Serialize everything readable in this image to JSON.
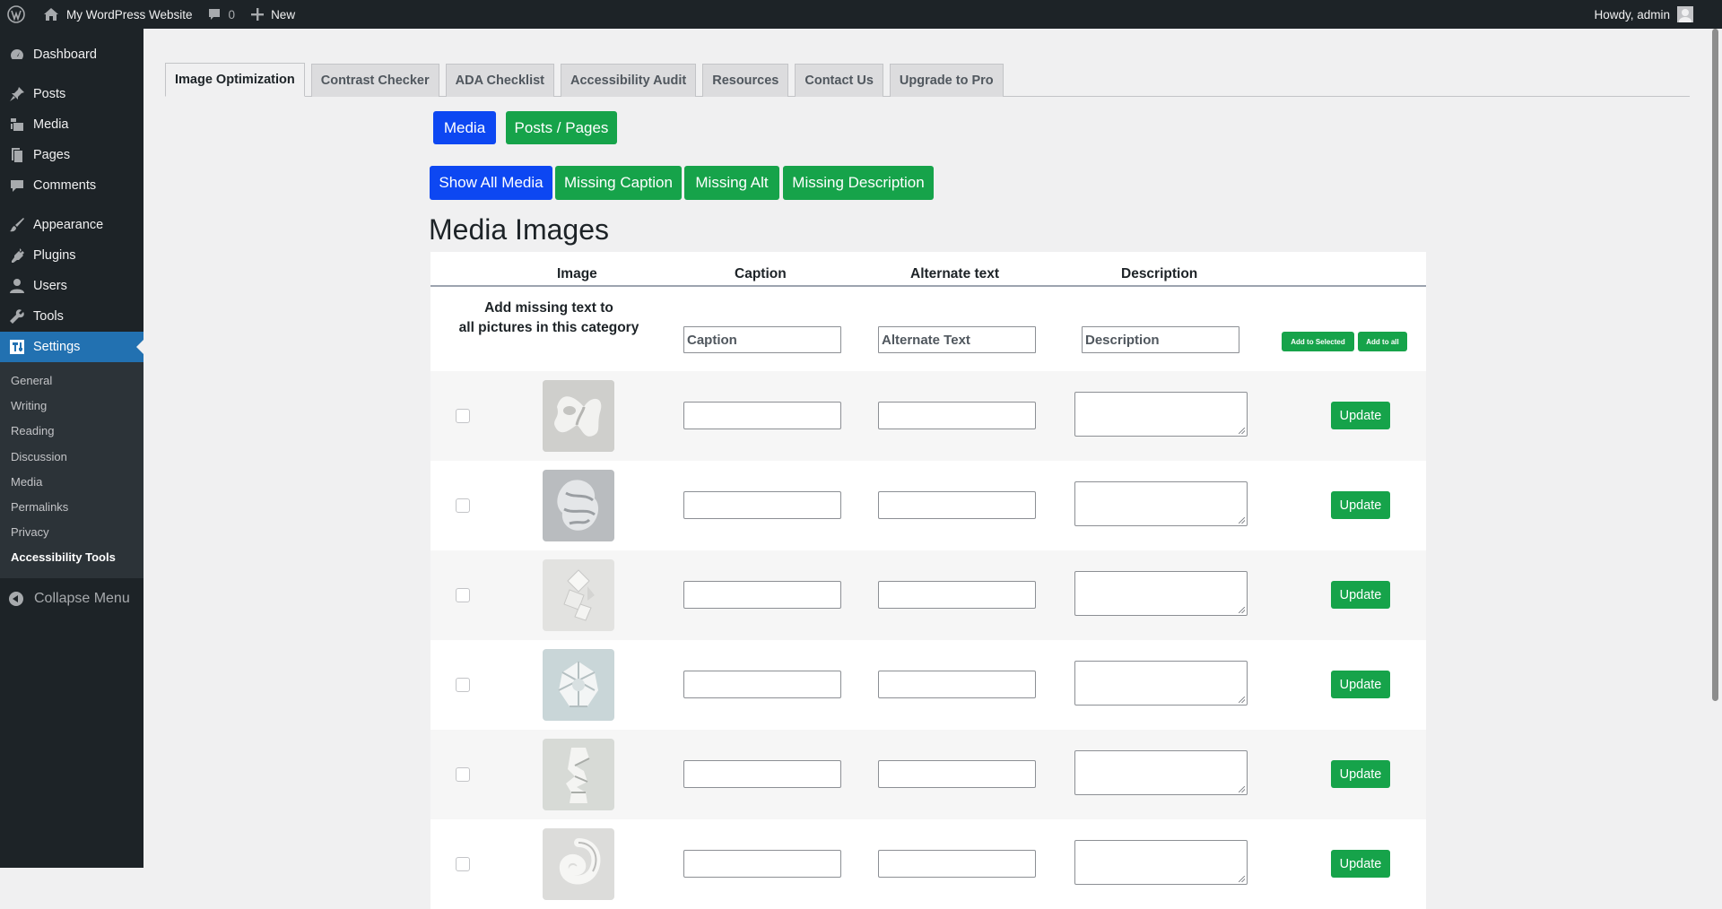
{
  "adminbar": {
    "site_name": "My WordPress Website",
    "comments_count": "0",
    "new_label": "New",
    "greeting": "Howdy, admin"
  },
  "sidebar": {
    "items": [
      {
        "label": "Dashboard",
        "icon": "dashboard-icon"
      },
      {
        "label": "Posts",
        "icon": "pin-icon"
      },
      {
        "label": "Media",
        "icon": "media-icon"
      },
      {
        "label": "Pages",
        "icon": "pages-icon"
      },
      {
        "label": "Comments",
        "icon": "comments-icon"
      },
      {
        "label": "Appearance",
        "icon": "brush-icon"
      },
      {
        "label": "Plugins",
        "icon": "plug-icon"
      },
      {
        "label": "Users",
        "icon": "user-icon"
      },
      {
        "label": "Tools",
        "icon": "wrench-icon"
      },
      {
        "label": "Settings",
        "icon": "settings-icon"
      }
    ],
    "submenu": [
      "General",
      "Writing",
      "Reading",
      "Discussion",
      "Media",
      "Permalinks",
      "Privacy",
      "Accessibility Tools"
    ],
    "collapse_label": "Collapse Menu"
  },
  "tabs": [
    "Image Optimization",
    "Contrast Checker",
    "ADA Checklist",
    "Accessibility Audit",
    "Resources",
    "Contact Us",
    "Upgrade to Pro"
  ],
  "source_buttons": {
    "media": "Media",
    "posts_pages": "Posts / Pages"
  },
  "filters": {
    "show_all": "Show All Media",
    "missing_caption": "Missing Caption",
    "missing_alt": "Missing Alt",
    "missing_description": "Missing Description"
  },
  "heading": "Media Images",
  "table": {
    "headers": {
      "image": "Image",
      "caption": "Caption",
      "alt": "Alternate text",
      "description": "Description"
    },
    "bulk": {
      "label_line1": "Add missing text to",
      "label_line2": "all pictures in this category",
      "caption_placeholder": "Caption",
      "alt_placeholder": "Alternate Text",
      "description_placeholder": "Description",
      "add_selected": "Add to Selected",
      "add_all": "Add to all"
    },
    "update_label": "Update"
  },
  "colors": {
    "primary_blue": "#0d47f2",
    "success_green": "#16a34a",
    "wp_admin_blue": "#2271b1",
    "sidebar_dark": "#1d2327"
  }
}
